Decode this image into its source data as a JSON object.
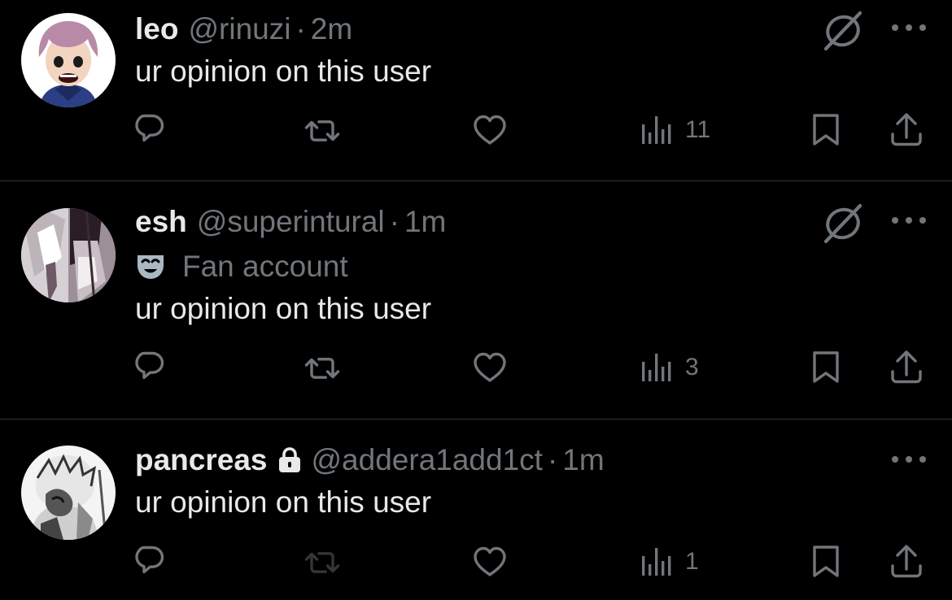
{
  "colors": {
    "background": "#000000",
    "primary_text": "#e7e9ea",
    "secondary_text": "#71767b",
    "divider": "#2f3336"
  },
  "tweets": [
    {
      "display_name": "leo",
      "handle": "@rinuzi",
      "separator": "·",
      "time": "2m",
      "text": "ur opinion on this user",
      "views": "11",
      "avatar_icon": "avatar-purple-hair-character",
      "has_grok_icon": true
    },
    {
      "display_name": "esh",
      "handle": "@superintural",
      "separator": "·",
      "time": "1m",
      "label": "Fan account",
      "label_icon": "mask-icon",
      "text": "ur opinion on this user",
      "views": "3",
      "avatar_icon": "avatar-manga-characters",
      "has_grok_icon": true
    },
    {
      "display_name": "pancreas",
      "protected_icon": "lock-icon",
      "handle": "@addera1add1ct",
      "separator": "·",
      "time": "1m",
      "text": "ur opinion on this user",
      "views": "1",
      "avatar_icon": "avatar-manga-sketch",
      "has_grok_icon": false
    }
  ],
  "action_icons": [
    "reply-icon",
    "repost-icon",
    "like-icon",
    "views-icon",
    "bookmark-icon",
    "share-icon"
  ]
}
